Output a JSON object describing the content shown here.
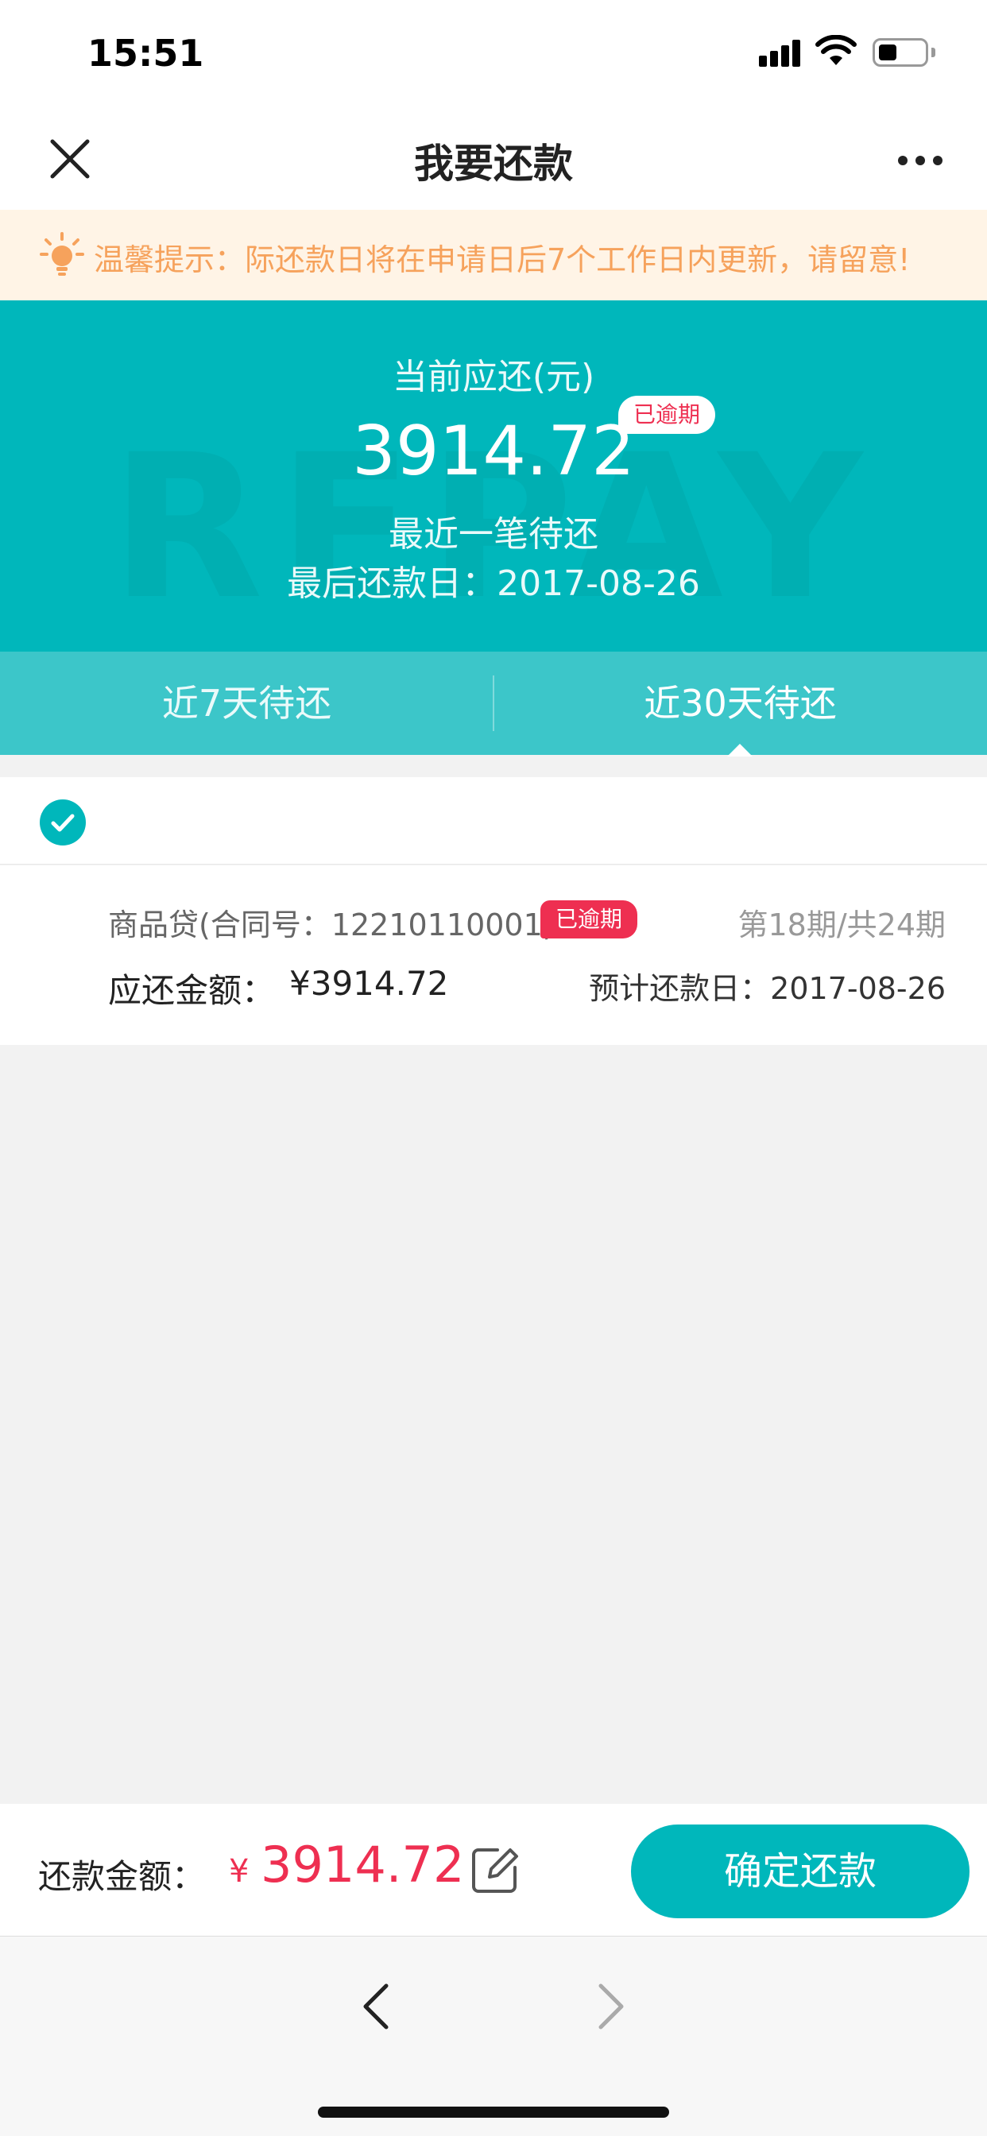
{
  "status_bar": {
    "time": "15:51"
  },
  "nav": {
    "title": "我要还款"
  },
  "notice": {
    "text": "温馨提示：际还款日将在申请日后7个工作日内更新，请留意!"
  },
  "summary": {
    "label": "当前应还(元)",
    "amount": "3914.72",
    "overdue_badge": "已逾期",
    "subtitle": "最近一笔待还",
    "due_date": "最后还款日：2017-08-26",
    "watermark": "REPAY"
  },
  "tabs": [
    {
      "label": "近7天待还",
      "active": false
    },
    {
      "label": "近30天待还",
      "active": true
    }
  ],
  "loan": {
    "name": "商品贷(合同号：12210110001)",
    "badge": "已逾期",
    "period": "第18期/共24期",
    "amount_label": "应还金额：",
    "amount": "¥3914.72",
    "due_date": "预计还款日：2017-08-26",
    "selected": true
  },
  "pay_bar": {
    "label": "还款金额：",
    "currency": "¥",
    "amount": "3914.72",
    "confirm_label": "确定还款"
  },
  "colors": {
    "accent": "#00b7bb",
    "tab_bg": "#3cc6c9",
    "danger": "#ee2f51",
    "notice_text": "#f6a25c",
    "notice_bg": "#fff4e6"
  },
  "icons": {
    "close": "close-icon",
    "more": "more-icon",
    "notice": "lightbulb-icon",
    "check": "check-circle-icon",
    "edit": "edit-icon",
    "back": "chevron-left-icon",
    "forward": "chevron-right-icon"
  }
}
